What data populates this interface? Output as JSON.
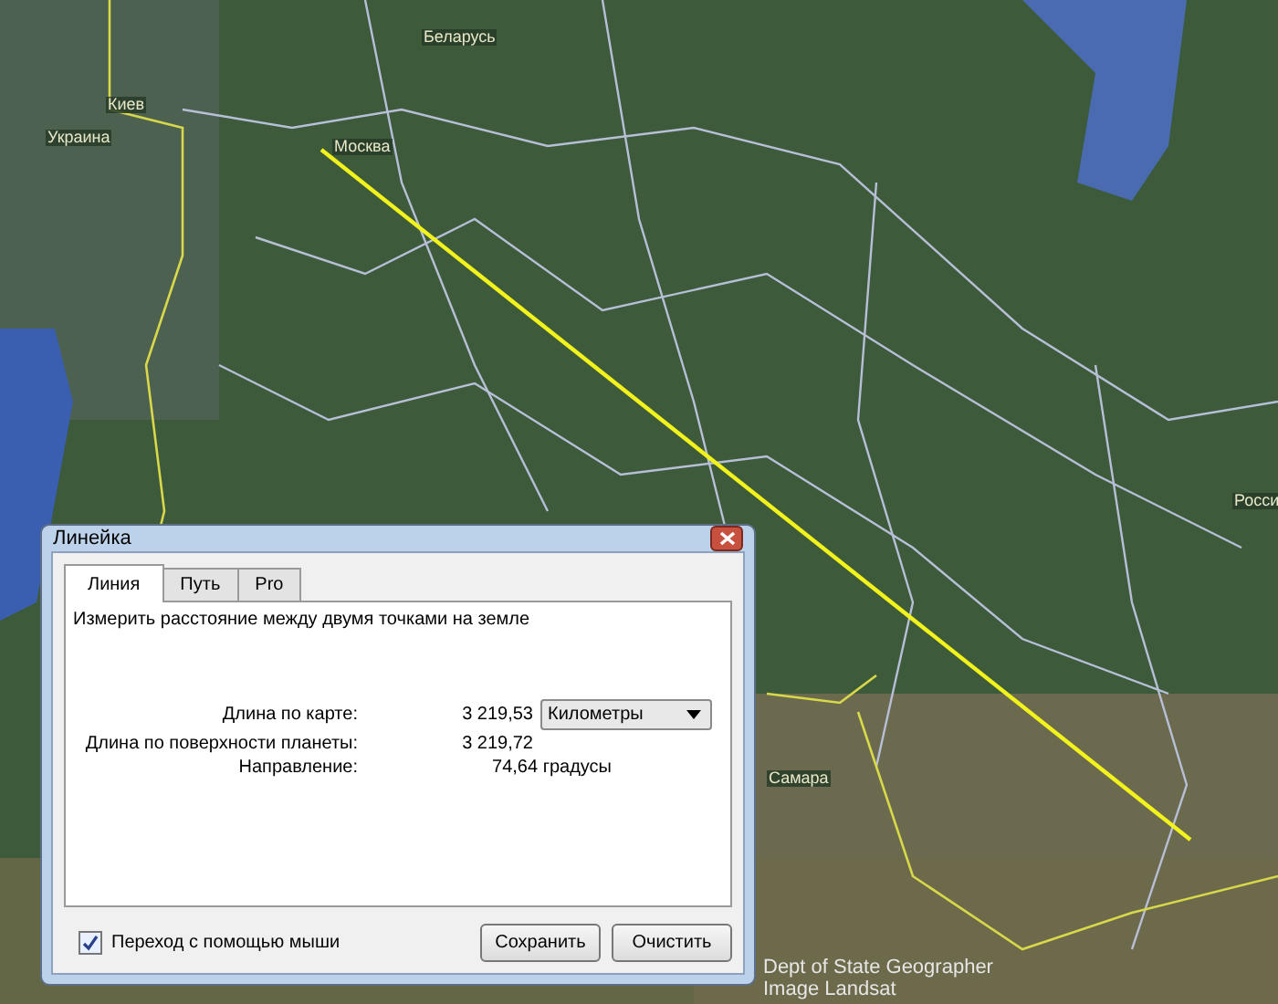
{
  "map": {
    "labels": [
      "Беларусь",
      "Киев",
      "Украина",
      "Москва",
      "Самара",
      "Росси"
    ],
    "attribution": [
      "Dept of State Geographer",
      "Image Landsat"
    ]
  },
  "dialog": {
    "title": "Линейка",
    "tabs": [
      {
        "label": "Линия",
        "selected": true
      },
      {
        "label": "Путь",
        "selected": false
      },
      {
        "label": "Pro",
        "selected": false
      }
    ],
    "description": "Измерить расстояние между двумя точками на земле",
    "map_length": {
      "label": "Длина по карте:",
      "value": "3 219,53",
      "unit": "Километры"
    },
    "ground_length": {
      "label": "Длина по поверхности планеты:",
      "value": "3 219,72"
    },
    "heading": {
      "label": "Направление:",
      "value": "74,64 градусы"
    },
    "mouse_navigation": {
      "label": "Переход с помощью мыши",
      "checked": true
    },
    "buttons": [
      "Сохранить",
      "Очистить"
    ]
  }
}
